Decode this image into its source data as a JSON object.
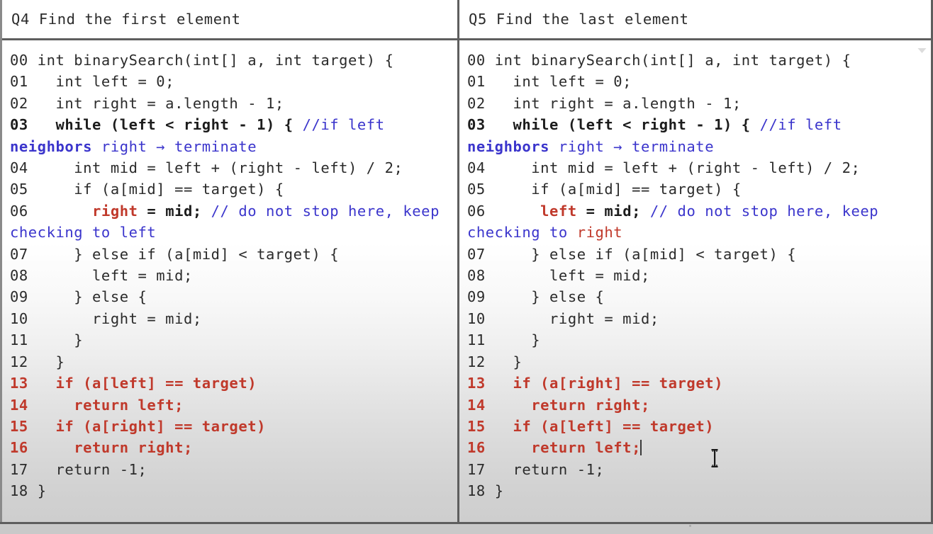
{
  "panels": [
    {
      "id": "left",
      "header": "Q4 Find the first element",
      "lines": [
        {
          "num": "00",
          "num_style": "normal",
          "segments": [
            {
              "t": " int binarySearch(int[] a, int target) {",
              "c": "plain"
            }
          ]
        },
        {
          "num": "01",
          "num_style": "normal",
          "segments": [
            {
              "t": "   int left = 0;",
              "c": "plain"
            }
          ]
        },
        {
          "num": "02",
          "num_style": "normal",
          "segments": [
            {
              "t": "   int right = a.length - 1;",
              "c": "plain"
            }
          ]
        },
        {
          "num": "03",
          "num_style": "bold",
          "segments": [
            {
              "t": "   while (left < right - 1) { ",
              "c": "bold"
            },
            {
              "t": "//if left ",
              "c": "blue"
            },
            {
              "t": "neighbors",
              "c": "blue-bold"
            },
            {
              "t": " right → terminate",
              "c": "blue"
            }
          ]
        },
        {
          "num": "04",
          "num_style": "normal",
          "segments": [
            {
              "t": "     int mid = left + (right - left) / 2;",
              "c": "plain"
            }
          ]
        },
        {
          "num": "05",
          "num_style": "normal",
          "segments": [
            {
              "t": "     if (a[mid] == target) {",
              "c": "plain"
            }
          ]
        },
        {
          "num": "06",
          "num_style": "normal",
          "segments": [
            {
              "t": "       ",
              "c": "plain"
            },
            {
              "t": "right",
              "c": "red-bold"
            },
            {
              "t": " = mid;",
              "c": "bold"
            },
            {
              "t": " // do not stop here, keep checking to left",
              "c": "blue"
            }
          ]
        },
        {
          "num": "07",
          "num_style": "normal",
          "segments": [
            {
              "t": "     } else if (a[mid] < target) {",
              "c": "plain"
            }
          ]
        },
        {
          "num": "08",
          "num_style": "normal",
          "segments": [
            {
              "t": "       left = mid;",
              "c": "plain"
            }
          ]
        },
        {
          "num": "09",
          "num_style": "normal",
          "segments": [
            {
              "t": "     } else {",
              "c": "plain"
            }
          ]
        },
        {
          "num": "10",
          "num_style": "normal",
          "segments": [
            {
              "t": "       right = mid;",
              "c": "plain"
            }
          ]
        },
        {
          "num": "11",
          "num_style": "normal",
          "segments": [
            {
              "t": "     }",
              "c": "plain"
            }
          ]
        },
        {
          "num": "12",
          "num_style": "normal",
          "segments": [
            {
              "t": "   }",
              "c": "plain"
            }
          ]
        },
        {
          "num": "13",
          "num_style": "red",
          "segments": [
            {
              "t": "   if (a[left] == target)",
              "c": "red-bold"
            }
          ]
        },
        {
          "num": "14",
          "num_style": "red",
          "segments": [
            {
              "t": "     return left;",
              "c": "red-bold"
            }
          ]
        },
        {
          "num": "15",
          "num_style": "red",
          "segments": [
            {
              "t": "   if (a[right] == target)",
              "c": "red-bold"
            }
          ]
        },
        {
          "num": "16",
          "num_style": "red",
          "segments": [
            {
              "t": "     return right;",
              "c": "red-bold"
            }
          ]
        },
        {
          "num": "17",
          "num_style": "normal",
          "segments": [
            {
              "t": "   return -1;",
              "c": "plain"
            }
          ]
        },
        {
          "num": "18",
          "num_style": "normal",
          "segments": [
            {
              "t": " }",
              "c": "plain"
            }
          ]
        }
      ]
    },
    {
      "id": "right",
      "header": "Q5 Find the last element",
      "lines": [
        {
          "num": "00",
          "num_style": "normal",
          "segments": [
            {
              "t": " int binarySearch(int[] a, int target) {",
              "c": "plain"
            }
          ]
        },
        {
          "num": "01",
          "num_style": "normal",
          "segments": [
            {
              "t": "   int left = 0;",
              "c": "plain"
            }
          ]
        },
        {
          "num": "02",
          "num_style": "normal",
          "segments": [
            {
              "t": "   int right = a.length - 1;",
              "c": "plain"
            }
          ]
        },
        {
          "num": "03",
          "num_style": "bold",
          "segments": [
            {
              "t": "   while (left < right - 1) { ",
              "c": "bold"
            },
            {
              "t": "//if left ",
              "c": "blue"
            },
            {
              "t": "neighbors",
              "c": "blue-bold"
            },
            {
              "t": " right → terminate",
              "c": "blue"
            }
          ]
        },
        {
          "num": "04",
          "num_style": "normal",
          "segments": [
            {
              "t": "     int mid = left + (right - left) / 2;",
              "c": "plain"
            }
          ]
        },
        {
          "num": "05",
          "num_style": "normal",
          "segments": [
            {
              "t": "     if (a[mid] == target) {",
              "c": "plain"
            }
          ]
        },
        {
          "num": "06",
          "num_style": "normal",
          "segments": [
            {
              "t": "      ",
              "c": "plain"
            },
            {
              "t": "left",
              "c": "red-bold"
            },
            {
              "t": " = mid;",
              "c": "bold"
            },
            {
              "t": " // do not stop here, keep checking to ",
              "c": "blue"
            },
            {
              "t": "right",
              "c": "red"
            }
          ]
        },
        {
          "num": "07",
          "num_style": "normal",
          "segments": [
            {
              "t": "     } else if (a[mid] < target) {",
              "c": "plain"
            }
          ]
        },
        {
          "num": "08",
          "num_style": "normal",
          "segments": [
            {
              "t": "       left = mid;",
              "c": "plain"
            }
          ]
        },
        {
          "num": "09",
          "num_style": "normal",
          "segments": [
            {
              "t": "     } else {",
              "c": "plain"
            }
          ]
        },
        {
          "num": "10",
          "num_style": "normal",
          "segments": [
            {
              "t": "       right = mid;",
              "c": "plain"
            }
          ]
        },
        {
          "num": "11",
          "num_style": "normal",
          "segments": [
            {
              "t": "     }",
              "c": "plain"
            }
          ]
        },
        {
          "num": "12",
          "num_style": "normal",
          "segments": [
            {
              "t": "   }",
              "c": "plain"
            }
          ]
        },
        {
          "num": "13",
          "num_style": "red",
          "segments": [
            {
              "t": "   if (a[right] == target)",
              "c": "red-bold"
            }
          ]
        },
        {
          "num": "14",
          "num_style": "red",
          "segments": [
            {
              "t": "     return right;",
              "c": "red-bold"
            }
          ]
        },
        {
          "num": "15",
          "num_style": "red",
          "segments": [
            {
              "t": "   if (a[left] == target)",
              "c": "red-bold"
            }
          ]
        },
        {
          "num": "16",
          "num_style": "red",
          "caret_after": true,
          "segments": [
            {
              "t": "     return left;",
              "c": "red-bold"
            }
          ]
        },
        {
          "num": "17",
          "num_style": "normal",
          "segments": [
            {
              "t": "   return -1;",
              "c": "plain"
            }
          ]
        },
        {
          "num": "18",
          "num_style": "normal",
          "segments": [
            {
              "t": " }",
              "c": "plain"
            }
          ]
        }
      ]
    }
  ],
  "icons": {
    "scroll_arrow": "chevron-down-icon",
    "mouse_cursor": "text-ibeam-cursor",
    "text_caret": "text-caret"
  },
  "colors": {
    "code_text": "#2b2b2b",
    "keyword_red": "#c0392b",
    "comment_blue": "#3b35cc",
    "panel_bg_top": "#ffffff",
    "panel_bg_bottom": "#cecece",
    "border": "#5e5e5e",
    "window_chrome": "#c9c9c9"
  }
}
